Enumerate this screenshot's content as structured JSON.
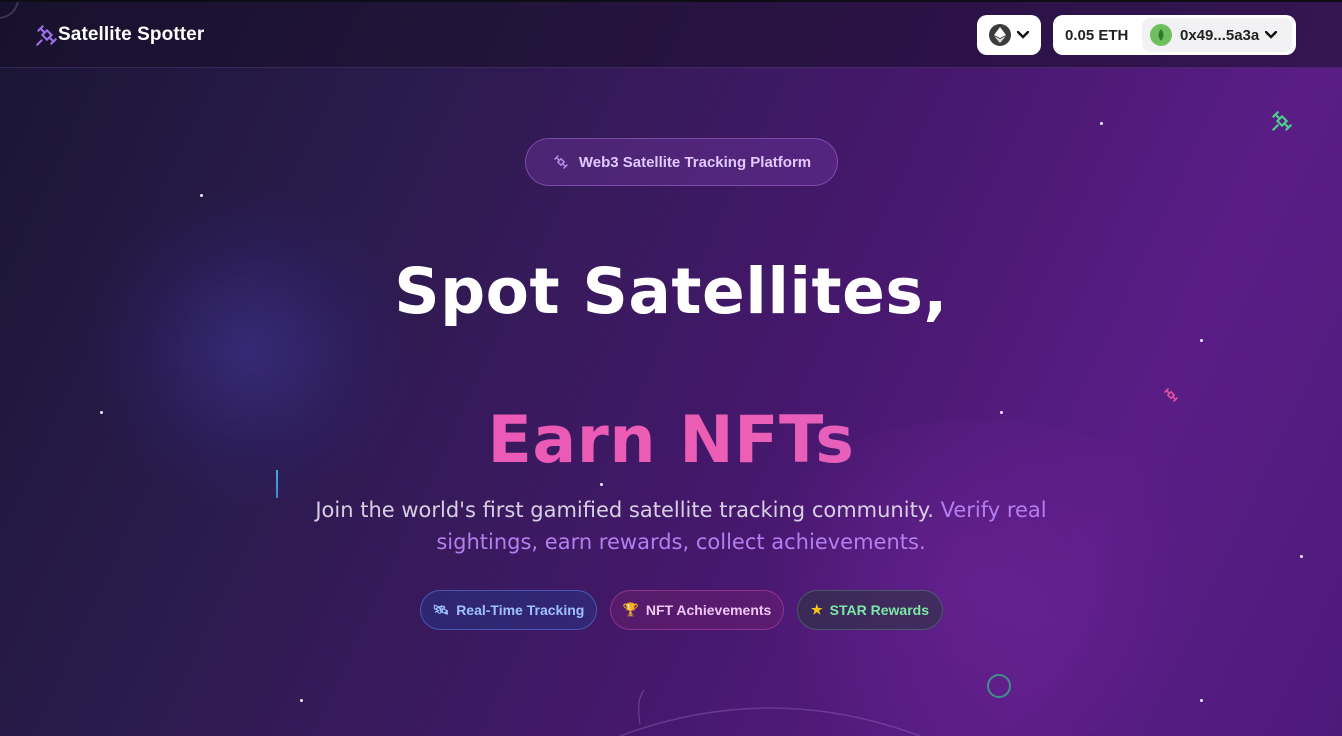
{
  "app": {
    "name": "Satellite Spotter"
  },
  "header": {
    "network": {
      "icon": "ethereum-icon"
    },
    "wallet": {
      "balance": "0.05 ETH",
      "address": "0x49...5a3a",
      "avatar_color": "#6fbf5e"
    }
  },
  "hero": {
    "badge": "Web3 Satellite Tracking Platform",
    "headline_line1": "Spot Satellites,",
    "headline_line2": "Earn NFTs",
    "subtitle_plain": "Join the world's first gamified satellite tracking community. ",
    "subtitle_highlight": "Verify real sightings, earn rewards, collect achievements.",
    "features": [
      {
        "label": "Real-Time Tracking",
        "icon": "satellite-icon",
        "color": "#9fc2ff"
      },
      {
        "label": "NFT Achievements",
        "icon": "trophy-icon",
        "color": "#eec7f6"
      },
      {
        "label": "STAR Rewards",
        "icon": "star-icon",
        "color": "#7ee8a8"
      }
    ]
  },
  "colors": {
    "accent_pink": "#ec5fb6",
    "accent_purple": "#b57ef0",
    "background_dark": "#191634",
    "background_purple": "#5a1d86"
  }
}
